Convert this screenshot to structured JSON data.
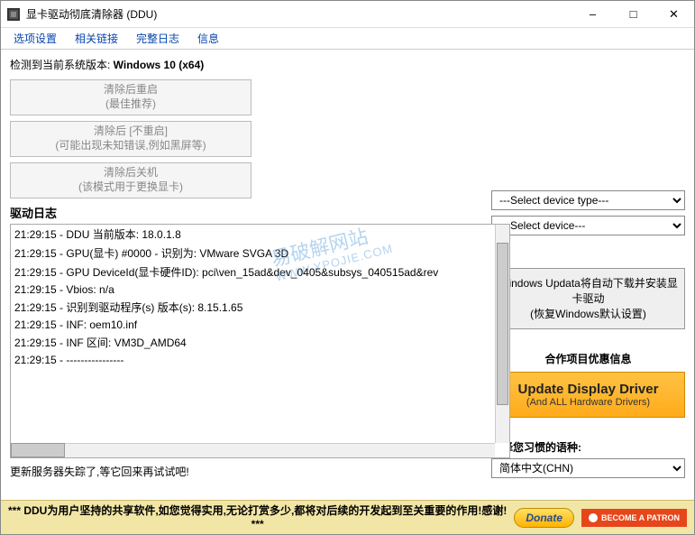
{
  "title": "显卡驱动彻底清除器 (DDU)",
  "menu": {
    "options": "选项设置",
    "links": "相关链接",
    "logs": "完整日志",
    "info": "信息"
  },
  "os": {
    "label": "检测到当前系统版本: ",
    "value": "Windows 10 (x64)"
  },
  "actions": {
    "btn1_line1": "清除后重启",
    "btn1_line2": "(最佳推荐)",
    "btn2_line1": "清除后 [不重启]",
    "btn2_line2": "(可能出现未知错误,例如黑屏等)",
    "btn3_line1": "清除后关机",
    "btn3_line2": "(该模式用于更换显卡)"
  },
  "logTitle": "驱动日志",
  "logs": [
    "21:29:15 - DDU 当前版本: 18.0.1.8",
    "21:29:15 - GPU(显卡) #0000 - 识别为: VMware SVGA 3D",
    "21:29:15 - GPU DeviceId(显卡硬件ID): pci\\ven_15ad&dev_0405&subsys_040515ad&rev",
    "21:29:15 - Vbios: n/a",
    "21:29:15 - 识别到驱动程序(s) 版本(s): 8.15.1.65",
    "21:29:15 - INF: oem10.inf",
    "21:29:15 - INF 区间: VM3D_AMD64",
    "21:29:15 - ----------------"
  ],
  "statusLine": "更新服务器失踪了,等它回来再试试吧!",
  "selects": {
    "deviceType": "---Select device type---",
    "device": "---Select device---"
  },
  "windowsUpdate": {
    "line1": "Windows Updata将自动下载并安装显卡驱动",
    "line2": "(恢复Windows默认设置)"
  },
  "partner": {
    "title": "合作项目优惠信息",
    "line1": "Update Display Driver",
    "line2": "(And ALL Hardware Drivers)"
  },
  "language": {
    "label": "选择您习惯的语种:",
    "value": "简体中文(CHN)"
  },
  "footer": {
    "text": "*** DDU为用户坚持的共享软件,如您觉得实用,无论打赏多少,都将对后续的开发起到至关重要的作用!感谢! ***",
    "donate": "Donate",
    "patreon": "BECOME A PATRON"
  },
  "watermark": {
    "line1": "易破解网站",
    "line2": "WWW.YPOJIE.COM"
  }
}
